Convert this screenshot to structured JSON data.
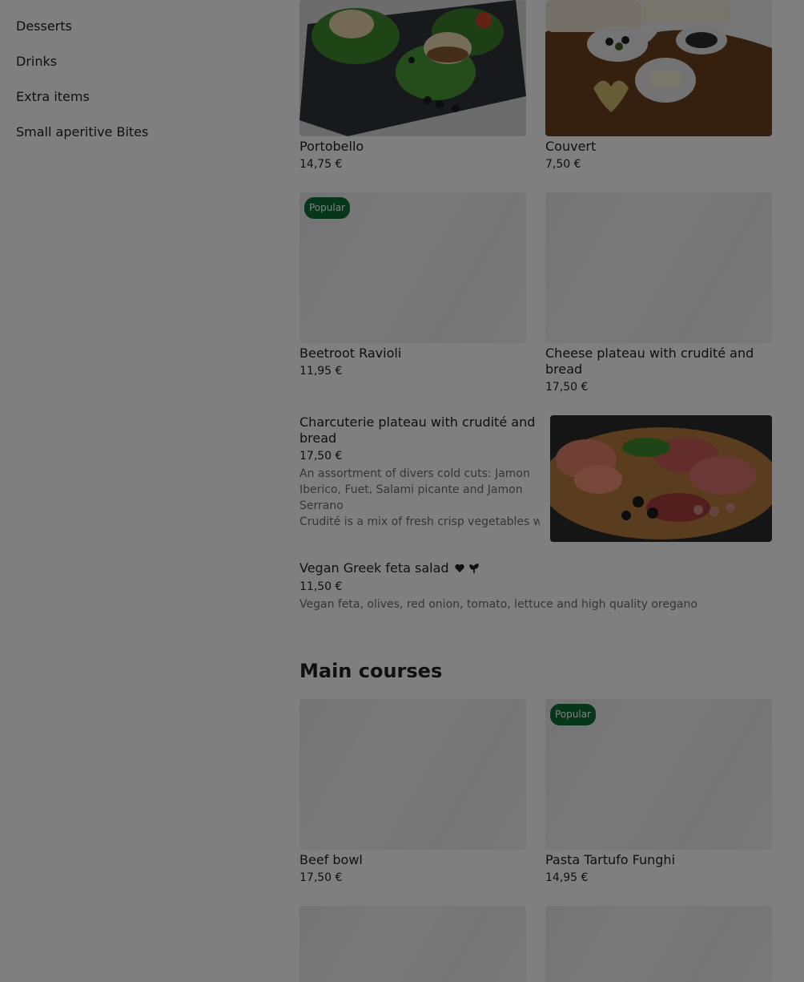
{
  "sidebar": {
    "items": [
      {
        "label": "Desserts"
      },
      {
        "label": "Drinks"
      },
      {
        "label": "Extra items"
      },
      {
        "label": "Small aperitive Bites"
      }
    ]
  },
  "menu": {
    "row1": [
      {
        "name": "Portobello",
        "price": "14,75 €"
      },
      {
        "name": "Couvert",
        "price": "7,50 €"
      }
    ],
    "row2": [
      {
        "name": "Beetroot Ravioli",
        "price": "11,95 €",
        "badge": "Popular"
      },
      {
        "name": "Cheese plateau with crudité and bread",
        "price": "17,50 €"
      }
    ],
    "charcuterie": {
      "name": "Charcuterie plateau with crudité and bread",
      "price": "17,50 €",
      "desc1": "An assortment of divers cold cuts: Jamon Iberico, Fuet, Salami picante and Jamon Serrano",
      "desc2": "Crudité is a mix of fresh crisp vegetables with…"
    },
    "vegan": {
      "name": "Vegan Greek feta salad",
      "price": "11,50 €",
      "desc": "Vegan feta, olives, red onion, tomato, lettuce and high quality oregano",
      "icons": [
        "heart-icon",
        "vegan-leaf-icon"
      ]
    }
  },
  "main_courses": {
    "title": "Main courses",
    "row1": [
      {
        "name": "Beef bowl",
        "price": "17,50 €"
      },
      {
        "name": "Pasta Tartufo Funghi",
        "price": "14,95 €",
        "badge": "Popular"
      }
    ]
  },
  "colors": {
    "badge_bg": "#0c6e35",
    "overlay": "rgba(0,0,0,0.5)",
    "text": "#202125",
    "desc": "#6b6d73"
  }
}
